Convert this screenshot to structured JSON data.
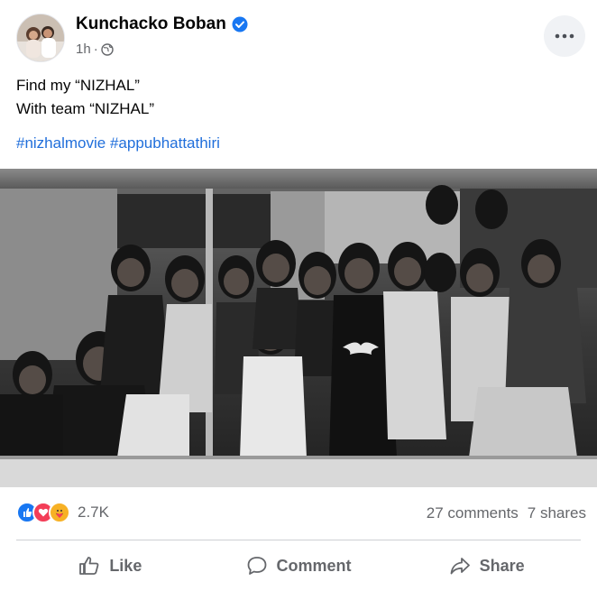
{
  "post": {
    "author": "Kunchacko Boban",
    "time": "1h",
    "separator": "·",
    "lines": [
      "Find my “NIZHAL”",
      "With team “NIZHAL”"
    ],
    "hashtags": [
      "#nizhalmovie",
      "#appubhattathiri"
    ]
  },
  "engagement": {
    "reactions": [
      "like",
      "love",
      "care"
    ],
    "reaction_count": "2.7K",
    "comments": "27 comments",
    "shares": "7 shares"
  },
  "actions": {
    "like": "Like",
    "comment": "Comment",
    "share": "Share"
  },
  "colors": {
    "link": "#216fdb",
    "verified": "#1877f2",
    "secondary": "#65676b",
    "like": "#1877f2",
    "love": "#f33e58",
    "care": "#f7b125"
  }
}
